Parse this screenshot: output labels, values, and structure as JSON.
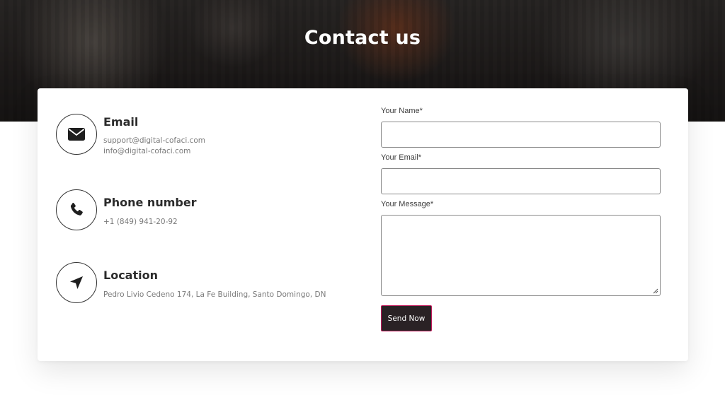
{
  "hero": {
    "title": "Contact us"
  },
  "contact_info": {
    "email": {
      "icon": "envelope-icon",
      "label": "Email",
      "lines": [
        "support@digital-cofaci.com",
        "info@digital-cofaci.com"
      ]
    },
    "phone": {
      "icon": "phone-icon",
      "label": "Phone number",
      "lines": [
        "+1 (849) 941-20-92"
      ]
    },
    "location": {
      "icon": "navigation-arrow-icon",
      "label": "Location",
      "lines": [
        "Pedro Livio Cedeno 174, La Fe Building, Santo Domingo, DN"
      ]
    }
  },
  "form": {
    "name_label": "Your Name*",
    "name_value": "",
    "email_label": "Your Email*",
    "email_value": "",
    "message_label": "Your Message*",
    "message_value": "",
    "submit_label": "Send Now"
  },
  "colors": {
    "button_bg": "#2a2225",
    "button_border": "#c2185b",
    "text_dark": "#2b2b2b",
    "text_muted": "#7a7a7a"
  }
}
